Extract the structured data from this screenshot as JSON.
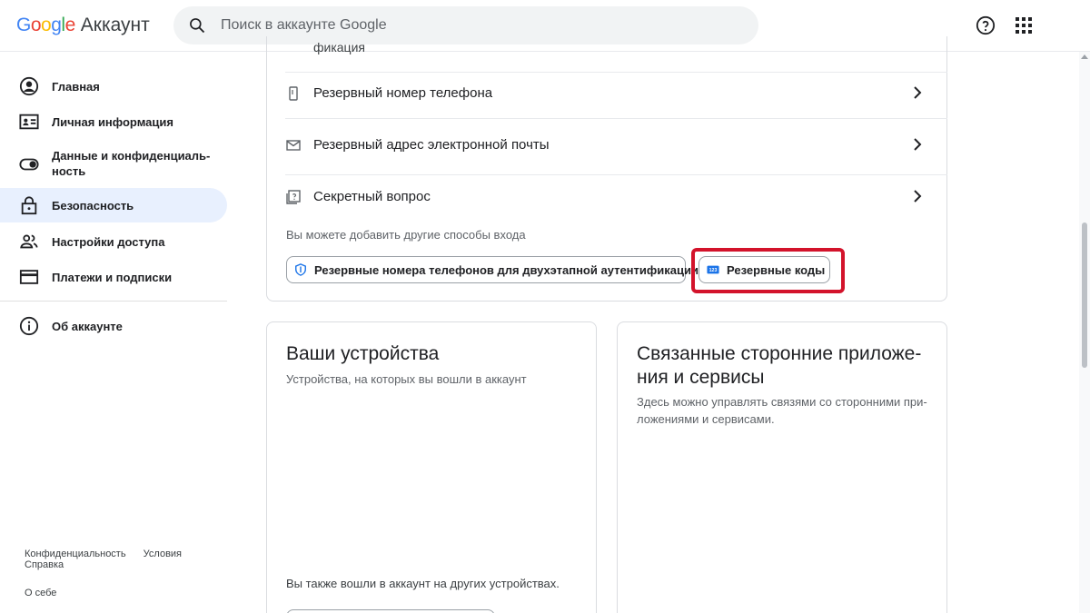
{
  "header": {
    "logo_google": "Google",
    "logo_product": "Аккаунт",
    "search_placeholder": "Поиск в аккаунте Google",
    "help_icon": "help-circle-icon",
    "apps_icon": "apps-grid-icon"
  },
  "sidebar": {
    "items": [
      {
        "label": "Главная",
        "icon": "account-circle-icon"
      },
      {
        "label": "Личная информация",
        "icon": "id-card-icon"
      },
      {
        "label": "Данные и конфиденциаль-",
        "label2": "ность",
        "icon": "toggle-icon"
      },
      {
        "label": "Безопасность",
        "icon": "lock-icon",
        "active": true
      },
      {
        "label": "Настройки доступа",
        "icon": "people-icon"
      },
      {
        "label": "Платежи и подписки",
        "icon": "credit-card-icon"
      },
      {
        "label": "Об аккаунте",
        "icon": "info-icon"
      }
    ],
    "footer": {
      "privacy": "Конфиденциальность",
      "terms": "Условия",
      "help": "Справка",
      "about": "О себе"
    }
  },
  "security": {
    "cut_text": "фикация",
    "rows": [
      {
        "label": "Резервный номер телефона",
        "icon": "phone-icon"
      },
      {
        "label": "Резервный адрес электронной почты",
        "icon": "mail-icon"
      },
      {
        "label": "Секретный вопрос",
        "icon": "question-box-icon"
      }
    ],
    "hint": "Вы можете добавить другие способы входа",
    "chips": [
      {
        "label": "Резервные номера телефонов для двухэтапной аутентификации",
        "icon": "shield-icon"
      },
      {
        "label": "Резервные коды",
        "icon": "backup-codes-icon",
        "highlighted": true
      }
    ],
    "highlight_color": "#d3132b"
  },
  "devices": {
    "title": "Ваши устройства",
    "subtitle": "Устройства, на которых вы вошли в аккаунт",
    "footer": "Вы также вошли в аккаунт на других устройствах."
  },
  "apps": {
    "title_line1": "Связанные сторонние приложе-",
    "title_line2": "ния и сервисы",
    "subtitle_line1": "Здесь можно управлять связями со сторонними при-",
    "subtitle_line2": "ложениями и сервисами."
  },
  "colors": {
    "accent": "#1a73e8",
    "active_bg": "#e8f0fe",
    "border": "#dadce0"
  }
}
